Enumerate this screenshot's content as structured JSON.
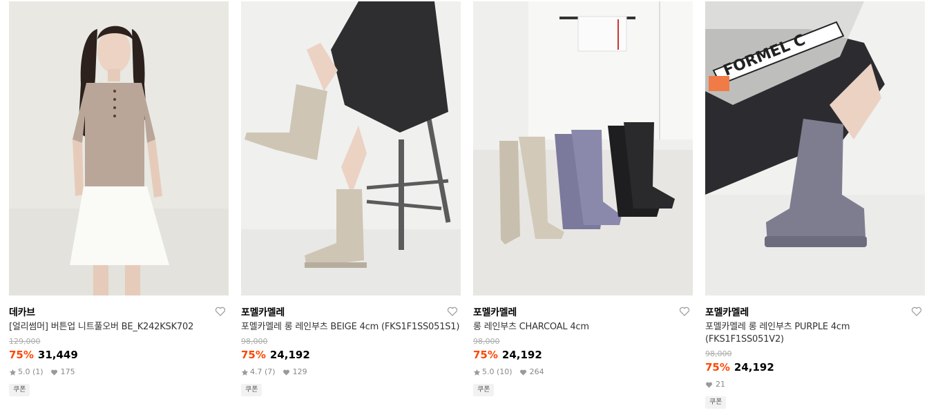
{
  "products": [
    {
      "brand": "데카브",
      "title": "[얼리썸머] 버튼업 니트풀오버 BE_K242KSK702",
      "title_line2": "",
      "original_price": "129,000",
      "discount": "75%",
      "price": "31,449",
      "rating": "5.0 (1)",
      "likes": "175",
      "coupon": "쿠폰"
    },
    {
      "brand": "포멜카멜레",
      "title": "포멜카멜레 롱 레인부츠 BEIGE 4cm (FKS1F1SS051S1)",
      "title_line2": "",
      "original_price": "98,000",
      "discount": "75%",
      "price": "24,192",
      "rating": "4.7 (7)",
      "likes": "129",
      "coupon": "쿠폰"
    },
    {
      "brand": "포멜카멜레",
      "title": "롱 레인부츠 CHARCOAL 4cm",
      "title_line2": "",
      "original_price": "98,000",
      "discount": "75%",
      "price": "24,192",
      "rating": "5.0 (10)",
      "likes": "264",
      "coupon": "쿠폰"
    },
    {
      "brand": "포멜카멜레",
      "title": "포멜카멜레 롱 레인부츠 PURPLE 4cm",
      "title_line2": "(FKS1F1SS051V2)",
      "original_price": "98,000",
      "discount": "75%",
      "price": "24,192",
      "rating": "",
      "likes": "21",
      "coupon": "쿠폰"
    }
  ],
  "image_overlay_text": "FORMEL C",
  "colors": {
    "discount": "#ff4800",
    "strike_price": "#aaaaaa",
    "meta": "#888888"
  }
}
